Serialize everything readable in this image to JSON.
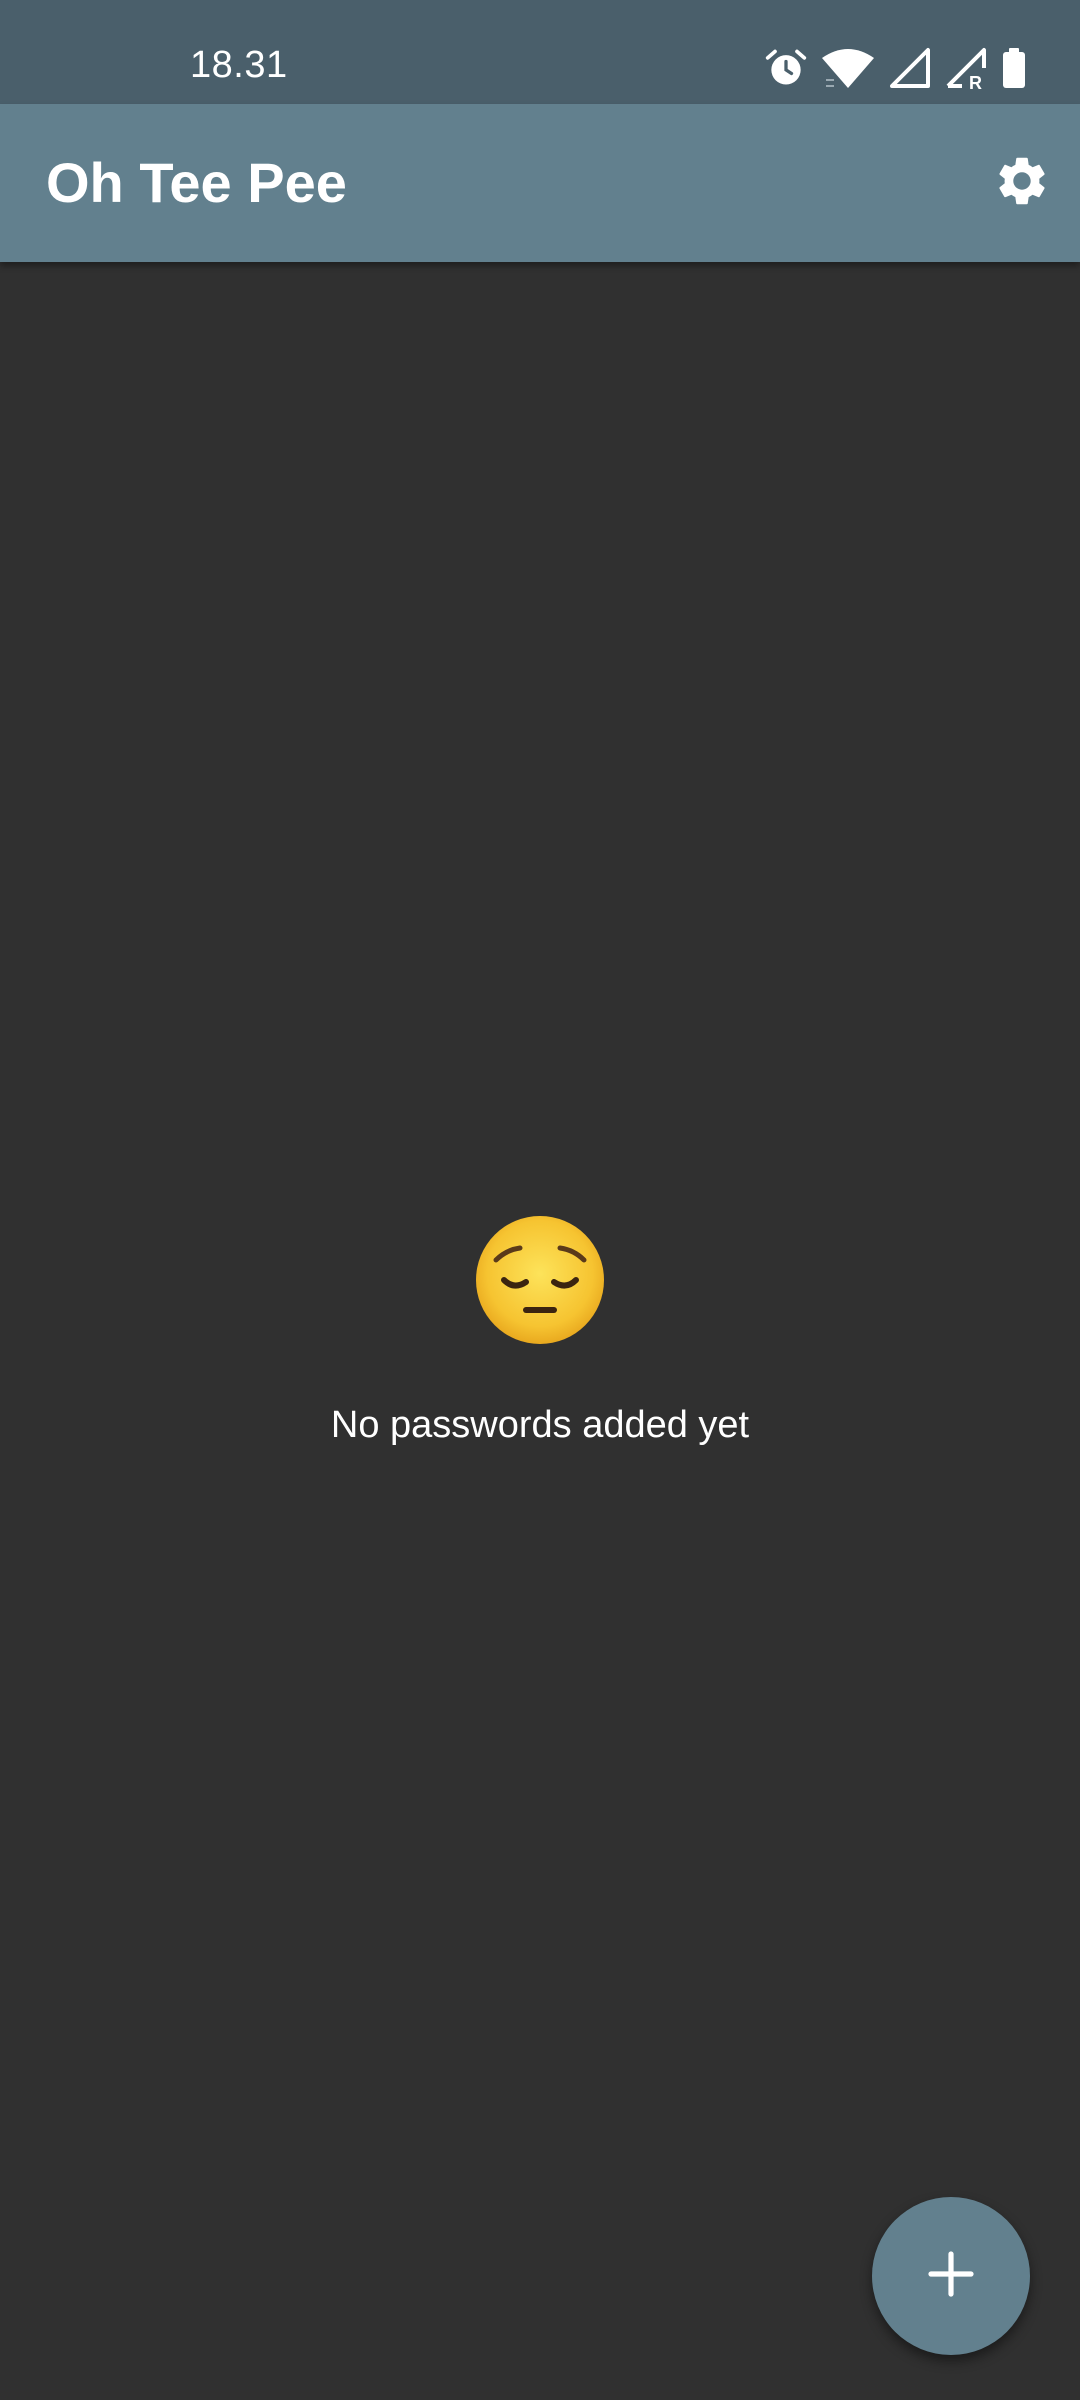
{
  "status_bar": {
    "time": "18.31",
    "icons": [
      "alarm-icon",
      "wifi-icon",
      "cell-signal-icon",
      "cell-signal-roaming-icon",
      "battery-icon"
    ]
  },
  "app_bar": {
    "title": "Oh Tee Pee",
    "settings_icon": "gear-icon"
  },
  "empty_state": {
    "emoji_icon": "pensive-face-icon",
    "message": "No passwords added yet"
  },
  "fab": {
    "icon": "plus-icon"
  },
  "colors": {
    "status_bar": "#4a5f6b",
    "app_bar": "#62808e",
    "background": "#303030",
    "fab": "#62808e",
    "text": "#ffffff"
  }
}
